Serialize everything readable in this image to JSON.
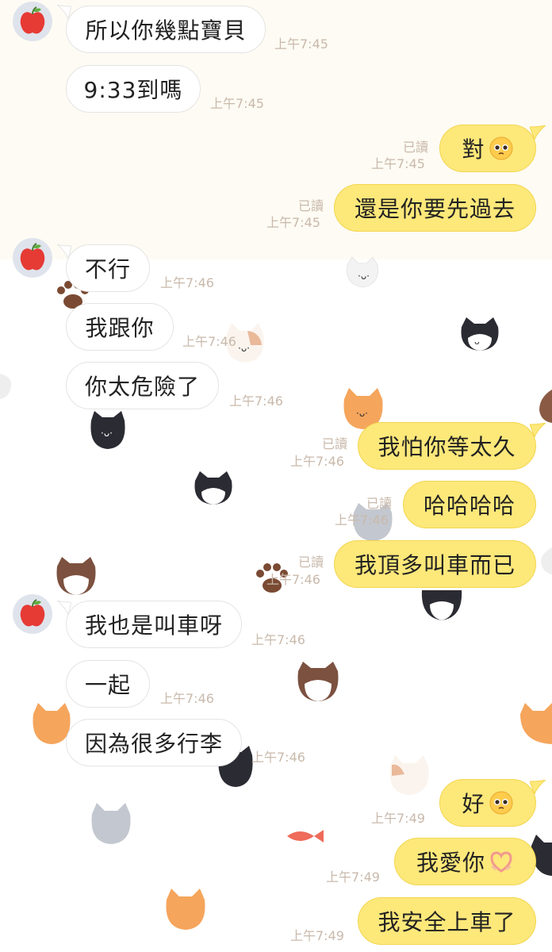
{
  "conversation": {
    "messages": [
      {
        "text": "所以你幾點寶貝",
        "time": "上午7:45"
      },
      {
        "text": "9:33到嗎",
        "time": "上午7:45"
      },
      {
        "text": "對",
        "time": "上午7:45",
        "read": "已讀",
        "emoji": "pleading-face-icon"
      },
      {
        "text": "還是你要先過去",
        "time": "上午7:45",
        "read": "已讀"
      },
      {
        "text": "不行",
        "time": "上午7:46"
      },
      {
        "text": "我跟你",
        "time": "上午7:46"
      },
      {
        "text": "你太危險了",
        "time": "上午7:46"
      },
      {
        "text": "我怕你等太久",
        "time": "上午7:46",
        "read": "已讀"
      },
      {
        "text": "哈哈哈哈",
        "time": "上午7:46",
        "read": "已讀"
      },
      {
        "text": "我頂多叫車而已",
        "time": "上午7:46",
        "read": "已讀"
      },
      {
        "text": "我也是叫車呀",
        "time": "上午7:46"
      },
      {
        "text": "一起",
        "time": "上午7:46"
      },
      {
        "text": "因為很多行李",
        "time": "上午7:46"
      },
      {
        "text": "好",
        "time": "上午7:49",
        "emoji": "pleading-face-icon"
      },
      {
        "text": "我愛你",
        "time": "上午7:49",
        "emoji": "heart-hands-icon"
      },
      {
        "text": "我安全上車了",
        "time": "上午7:49"
      }
    ]
  },
  "contact": {
    "avatar_icon": "apple-icon"
  },
  "colors": {
    "outgoing_bubble": "#fde87a",
    "incoming_bubble": "#ffffff",
    "meta_text": "#c9b9ab",
    "top_background": "#fdfbf3"
  }
}
